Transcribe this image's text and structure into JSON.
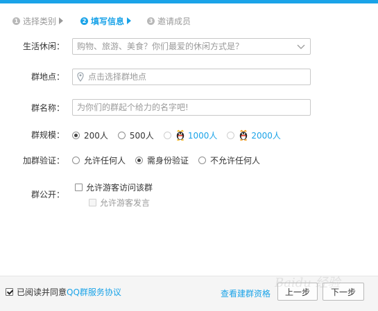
{
  "steps": [
    {
      "num": "1",
      "label": "选择类别",
      "active": false
    },
    {
      "num": "2",
      "label": "填写信息",
      "active": true
    },
    {
      "num": "3",
      "label": "邀请成员",
      "active": false
    }
  ],
  "form": {
    "leisure": {
      "label": "生活休闲：",
      "placeholder": "购物、旅游、美食？你们最爱的休闲方式是？"
    },
    "location": {
      "label": "群地点：",
      "placeholder": "点击选择群地点"
    },
    "name": {
      "label": "群名称：",
      "placeholder": "为你们的群起个给力的名字吧!"
    },
    "scale": {
      "label": "群规模：",
      "options": [
        {
          "label": "200人",
          "selected": true
        },
        {
          "label": "500人",
          "selected": false
        },
        {
          "label": "1000人",
          "selected": false,
          "vip": true
        },
        {
          "label": "2000人",
          "selected": false,
          "vip": true
        }
      ]
    },
    "verify": {
      "label": "加群验证：",
      "options": [
        {
          "label": "允许任何人",
          "selected": false
        },
        {
          "label": "需身份验证",
          "selected": true
        },
        {
          "label": "不允许任何人",
          "selected": false
        }
      ]
    },
    "public": {
      "label": "群公开：",
      "allow_visit": {
        "label": "允许游客访问该群",
        "checked": false
      },
      "allow_speak": {
        "label": "允许游客发言",
        "checked": false,
        "disabled": true
      }
    }
  },
  "footer": {
    "agree_text": "已阅读并同意",
    "agree_link": "QQ群服务协议",
    "agree_checked": true,
    "view_link": "查看建群资格",
    "prev_label": "上一步",
    "next_label": "下一步"
  },
  "watermark": {
    "text": "Baidu 经验"
  },
  "colors": {
    "accent": "#1aa3e8",
    "text": "#333333",
    "muted": "#9a9a9a"
  }
}
